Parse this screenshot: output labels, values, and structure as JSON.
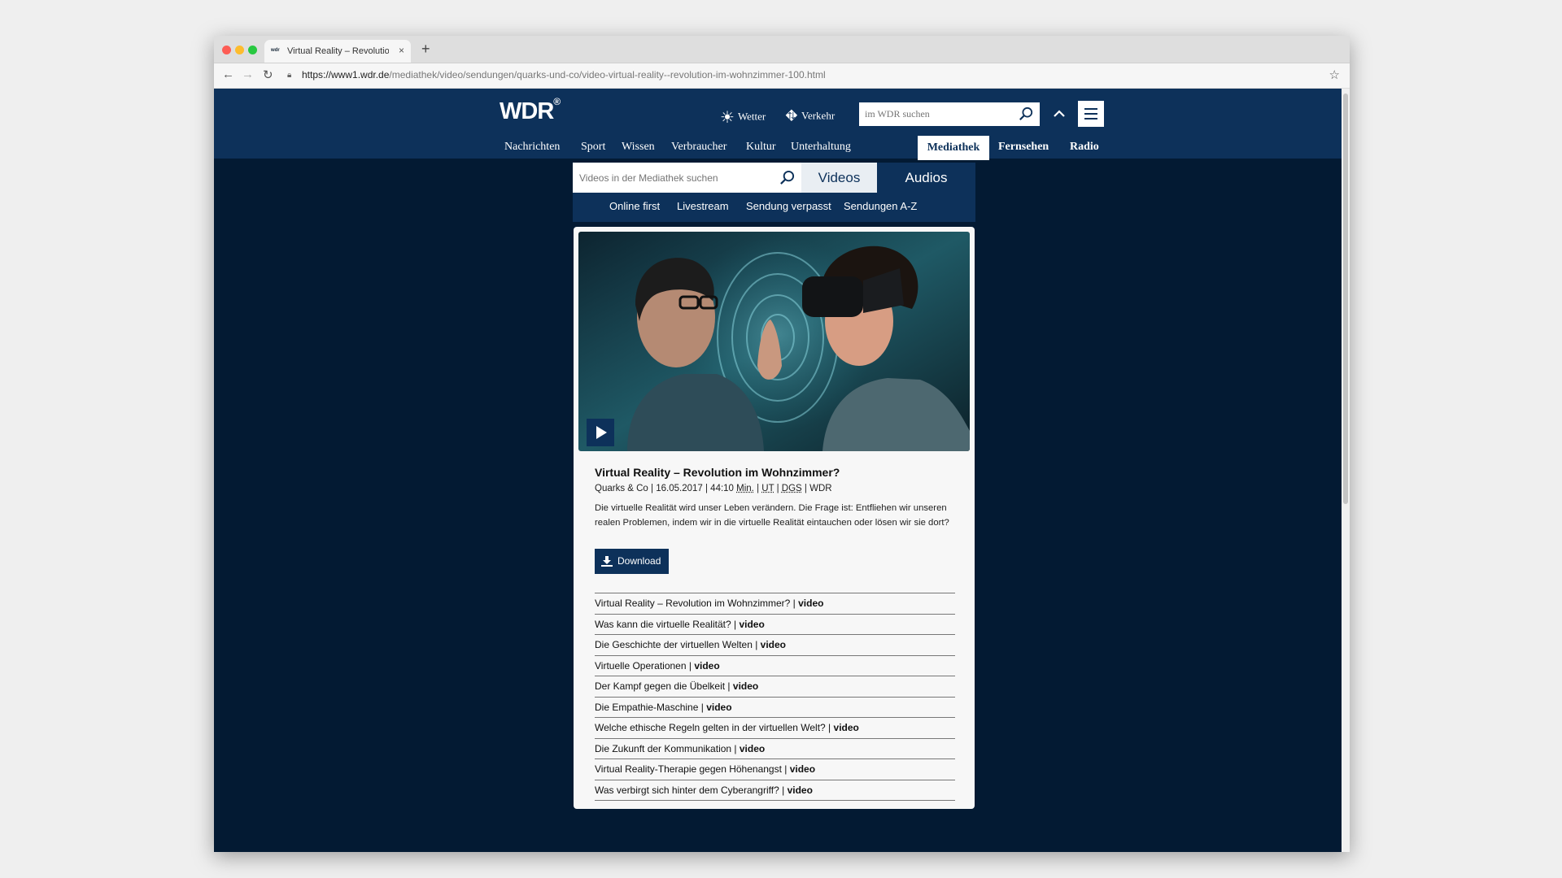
{
  "browser": {
    "tab_title": "Virtual Reality – Revolution im",
    "tab_favicon": "wdr",
    "url_host": "https://www1.wdr.de",
    "url_path": "/mediathek/video/sendungen/quarks-und-co/video-virtual-reality--revolution-im-wohnzimmer-100.html",
    "icons": [
      "close-icon",
      "plus-icon",
      "back-arrow-icon",
      "forward-arrow-icon",
      "reload-icon",
      "lock-icon",
      "star-icon"
    ]
  },
  "header": {
    "logo": "WDR",
    "logo_mark": "®",
    "weather_label": "Wetter",
    "traffic_label": "Verkehr",
    "search_placeholder": "im WDR suchen"
  },
  "nav": {
    "items": [
      "Nachrichten",
      "Sport",
      "Wissen",
      "Verbraucher",
      "Kultur",
      "Unterhaltung"
    ],
    "active": "Mediathek",
    "right_items": [
      "Fernsehen",
      "Radio"
    ]
  },
  "mediathek": {
    "search_placeholder": "Videos in der Mediathek suchen",
    "tab_videos": "Videos",
    "tab_audios": "Audios",
    "subnav": [
      "Online first",
      "Livestream",
      "Sendung verpasst",
      "Sendungen A-Z"
    ]
  },
  "video": {
    "title": "Virtual Reality – Revolution im Wohnzimmer?",
    "meta_show": "Quarks & Co",
    "meta_date": "16.05.2017",
    "meta_duration": "44:10",
    "meta_min": "Min.",
    "meta_ut": "UT",
    "meta_dgs": "DGS",
    "meta_channel": "WDR",
    "description": "Die virtuelle Realität wird unser Leben verändern. Die Frage ist: Entfliehen wir unseren realen Problemen, indem wir in die virtuelle Realität eintauchen oder lösen wir sie dort?",
    "download_label": "Download"
  },
  "chapters": [
    {
      "title": "Virtual Reality – Revolution im Wohnzimmer?",
      "type": "video"
    },
    {
      "title": "Was kann die virtuelle Realität?",
      "type": "video"
    },
    {
      "title": "Die Geschichte der virtuellen Welten",
      "type": "video"
    },
    {
      "title": "Virtuelle Operationen",
      "type": "video"
    },
    {
      "title": "Der Kampf gegen die Übelkeit",
      "type": "video"
    },
    {
      "title": "Die Empathie-Maschine",
      "type": "video"
    },
    {
      "title": "Welche ethische Regeln gelten in der virtuellen Welt?",
      "type": "video"
    },
    {
      "title": "Die Zukunft der Kommunikation",
      "type": "video"
    },
    {
      "title": "Virtual Reality-Therapie gegen Höhenangst",
      "type": "video"
    },
    {
      "title": "Was verbirgt sich hinter dem Cyberangriff?",
      "type": "video"
    }
  ],
  "colors": {
    "header_blue": "#0d315a",
    "page_bg": "#031a33",
    "card_bg": "#f7f7f7"
  }
}
